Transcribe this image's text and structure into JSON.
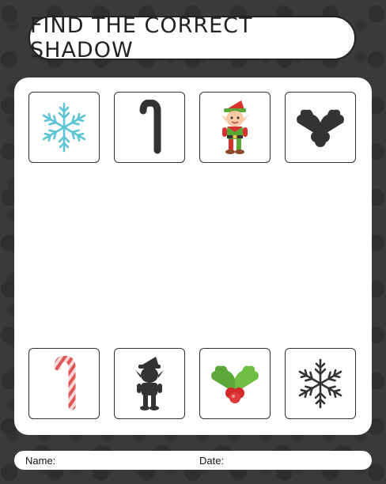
{
  "title": "FIND THE CORRECT SHADOW",
  "top_row": [
    {
      "item": "snowflake",
      "style": "color"
    },
    {
      "item": "candy-cane",
      "style": "shadow"
    },
    {
      "item": "elf",
      "style": "color"
    },
    {
      "item": "holly",
      "style": "shadow"
    }
  ],
  "bottom_row": [
    {
      "item": "candy-cane",
      "style": "color"
    },
    {
      "item": "elf",
      "style": "shadow"
    },
    {
      "item": "holly",
      "style": "color"
    },
    {
      "item": "snowflake",
      "style": "shadow"
    }
  ],
  "footer": {
    "name_label": "Name:",
    "date_label": "Date:"
  },
  "colors": {
    "background": "#3a3a3a",
    "shadow": "#333333",
    "snowflake": "#5bc4d6",
    "candy_red": "#e05555",
    "holly_green": "#5aa837",
    "berry_red": "#d4282b"
  }
}
